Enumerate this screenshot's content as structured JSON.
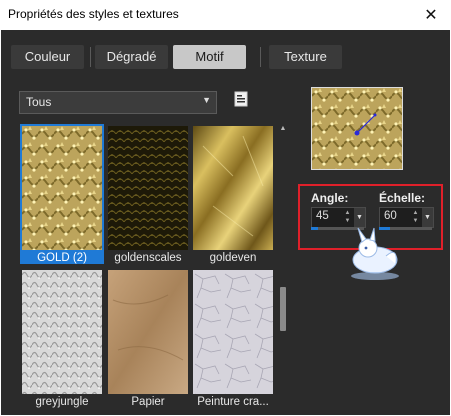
{
  "window": {
    "title": "Propriétés des styles et textures",
    "close_glyph": "✕"
  },
  "tabs": [
    {
      "label": "Couleur",
      "active": false
    },
    {
      "label": "Dégradé",
      "active": false
    },
    {
      "label": "Motif",
      "active": true
    },
    {
      "label": "Texture",
      "active": false
    }
  ],
  "category_dropdown": {
    "selected": "Tous"
  },
  "browse_icon": "pattern-browse-icon",
  "patterns": [
    {
      "name": "GOLD (2)",
      "selected": true
    },
    {
      "name": "goldenscales",
      "selected": false
    },
    {
      "name": "goldeven",
      "selected": false
    },
    {
      "name": "greyjungle",
      "selected": false
    },
    {
      "name": "Papier",
      "selected": false
    },
    {
      "name": "Peinture craquelée",
      "label_display": "Peinture cra...",
      "selected": false
    }
  ],
  "settings": {
    "angle_label": "Angle:",
    "angle_value": "45",
    "angle_fraction": 0.13,
    "scale_label": "Échelle:",
    "scale_value": "60",
    "scale_fraction": 0.2
  },
  "colors": {
    "highlight": "#e0202a",
    "selection": "#1f7ad6",
    "panel": "#2b2b2b"
  }
}
